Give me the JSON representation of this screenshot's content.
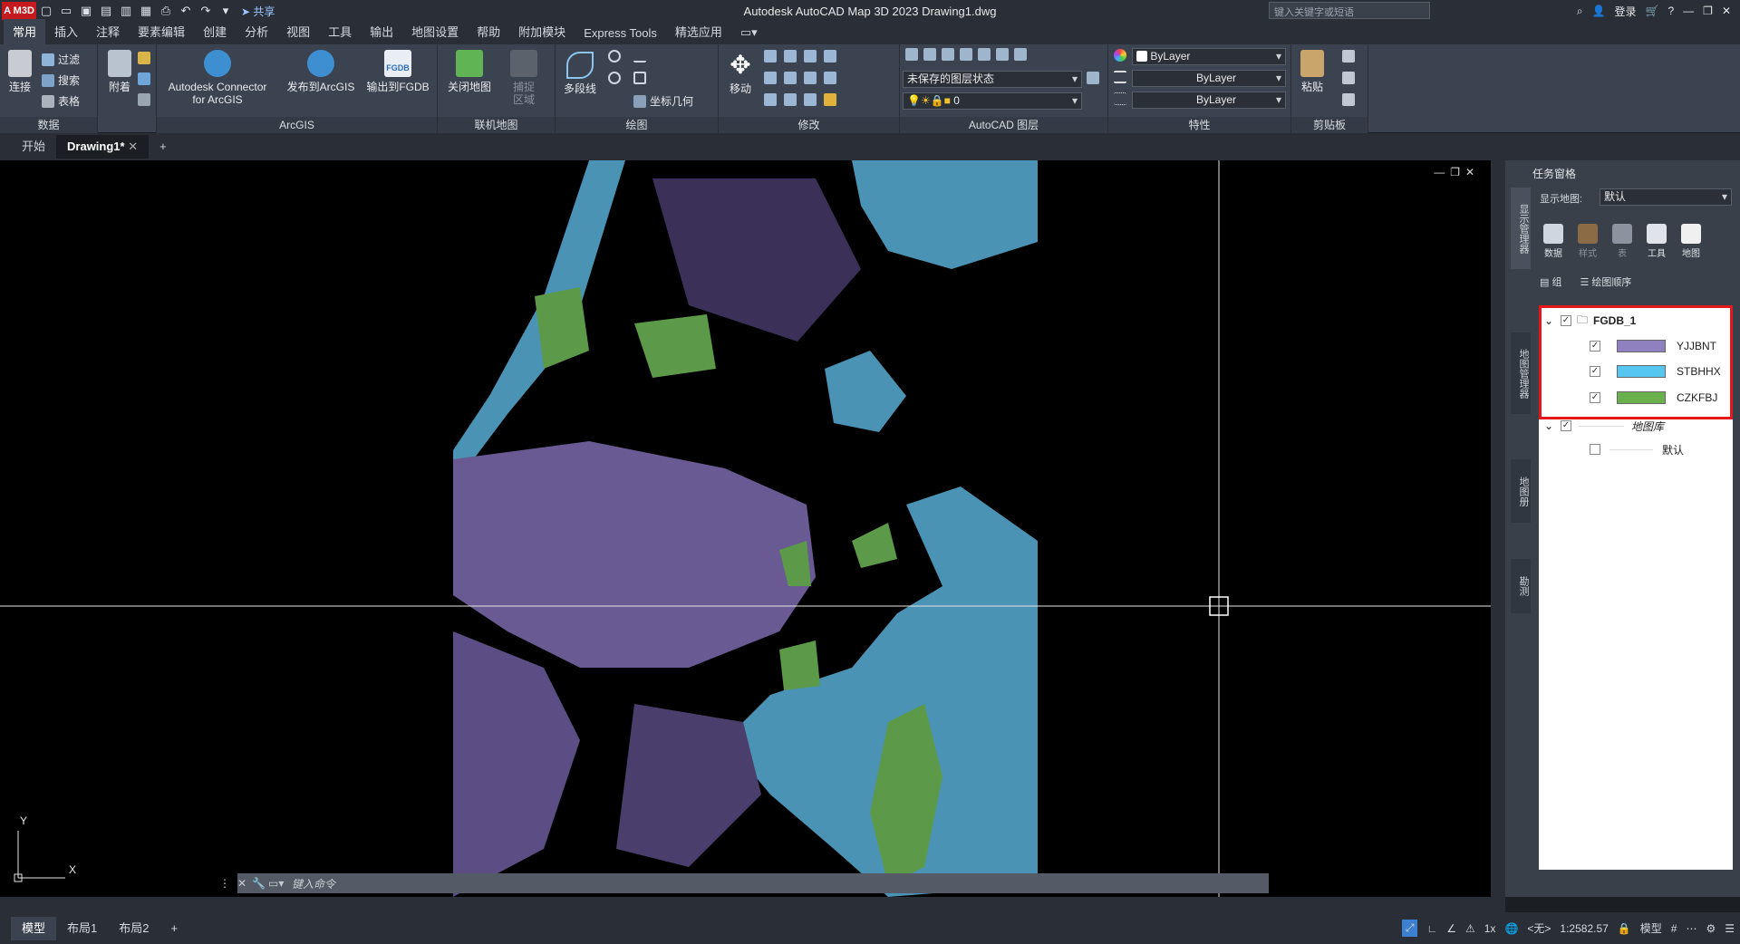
{
  "app": {
    "logo": "A M3D",
    "title": "Autodesk AutoCAD Map 3D 2023    Drawing1.dwg",
    "search_placeholder": "键入关键字或短语",
    "share": "共享",
    "login": "登录"
  },
  "ribbon_tabs": [
    "常用",
    "插入",
    "注释",
    "要素编辑",
    "创建",
    "分析",
    "视图",
    "工具",
    "输出",
    "地图设置",
    "帮助",
    "附加模块",
    "Express Tools",
    "精选应用"
  ],
  "panels": {
    "data": {
      "title": "数据",
      "connect": "连接",
      "filter": "过滤",
      "search": "搜索",
      "table": "表格",
      "attach": "附着"
    },
    "arcgis": {
      "title": "ArcGIS",
      "connector": "Autodesk Connector",
      "connector2": "for ArcGIS",
      "publish": "发布到ArcGIS",
      "export": "输出到FGDB",
      "fgdb_badge": "FGDB"
    },
    "online": {
      "title": "联机地图",
      "close": "关闭地图",
      "capture": "捕捉",
      "capture2": "区域"
    },
    "draw": {
      "title": "绘图",
      "polyline": "多段线",
      "coord_geom": "坐标几何"
    },
    "modify": {
      "title": "修改",
      "move": "移动"
    },
    "layers": {
      "title": "AutoCAD 图层",
      "state": "未保存的图层状态",
      "layer": "0"
    },
    "props": {
      "title": "特性",
      "color": "ByLayer",
      "linetype": "ByLayer",
      "lineweight": "ByLayer"
    },
    "clipboard": {
      "title": "剪贴板",
      "paste": "粘贴"
    }
  },
  "file_tabs": {
    "start": "开始",
    "drawing": "Drawing1*"
  },
  "command_placeholder": "键入命令",
  "ucs": {
    "x": "X",
    "y": "Y"
  },
  "task_pane": {
    "header": "任务窗格",
    "display_map_label": "显示地图:",
    "display_map_value": "默认",
    "tools": [
      "数据",
      "样式",
      "表",
      "工具",
      "地图"
    ],
    "group_btn": "组",
    "draw_order_btn": "绘图顺序",
    "vertical_tabs": [
      "显示管理器",
      "地图管理器",
      "地图册",
      "勘测"
    ],
    "layers": [
      {
        "name": "FGDB_1",
        "type": "group",
        "checked": true
      },
      {
        "name": "YJJBNT",
        "color": "#8f80c0",
        "checked": true
      },
      {
        "name": "STBHHX",
        "color": "#55c6f0",
        "checked": true
      },
      {
        "name": "CZKFBJ",
        "color": "#6ab04c",
        "checked": true
      }
    ],
    "library": {
      "name": "地图库",
      "checked": true
    },
    "default": {
      "name": "默认",
      "checked": false
    }
  },
  "status": {
    "layout_tabs": [
      "模型",
      "布局1",
      "布局2"
    ],
    "scale": "1:2582.57",
    "model": "模型",
    "zoom": "1x",
    "none": "<无>"
  },
  "map_colors": {
    "purple": "#6a5a94",
    "blue": "#4a93b4",
    "green": "#5c9a4a"
  }
}
